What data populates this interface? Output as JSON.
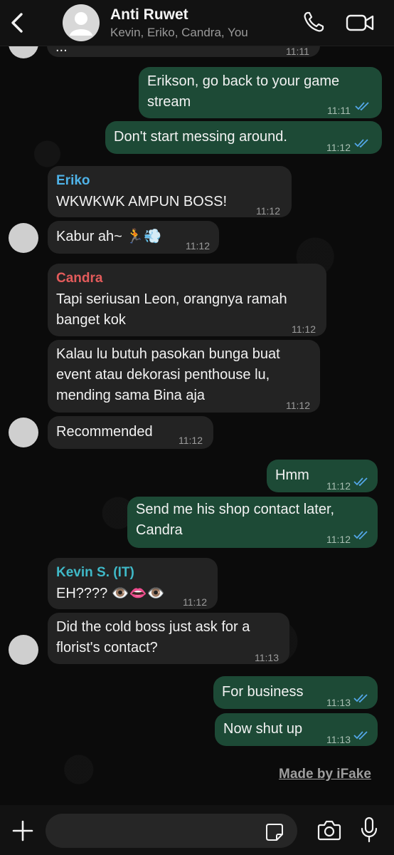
{
  "header": {
    "title": "Anti Ruwet",
    "members": "Kevin, Eriko, Candra, You"
  },
  "messages": [
    {
      "dir": "in",
      "text": "...",
      "time": "11:11"
    },
    {
      "dir": "out",
      "line1": "Erikson, go back to your game",
      "line2": "stream",
      "time": "11:11"
    },
    {
      "dir": "out",
      "text": "Don't start messing around.",
      "time": "11:12"
    },
    {
      "dir": "in",
      "sender": "Eriko",
      "sender_color": "#4fb3e8",
      "text": "WKWKWK AMPUN BOSS!",
      "time": "11:12"
    },
    {
      "dir": "in",
      "text": "Kabur ah~ 🏃💨",
      "time": "11:12"
    },
    {
      "dir": "in",
      "sender": "Candra",
      "sender_color": "#e35b5b",
      "line1": "Tapi seriusan Leon, orangnya ramah",
      "line2": "banget kok",
      "time": "11:12"
    },
    {
      "dir": "in",
      "line1": "Kalau lu butuh pasokan bunga buat",
      "line2": "event atau dekorasi penthouse lu,",
      "line3": "mending sama Bina aja",
      "time": "11:12"
    },
    {
      "dir": "in",
      "text": "Recommended",
      "time": "11:12"
    },
    {
      "dir": "out",
      "text": "Hmm",
      "time": "11:12"
    },
    {
      "dir": "out",
      "line1": "Send me his shop contact later,",
      "line2": "Candra",
      "time": "11:12"
    },
    {
      "dir": "in",
      "sender": "Kevin S. (IT)",
      "sender_color": "#3fb9c8",
      "text": "EH???? 👁️👄👁️",
      "time": "11:12"
    },
    {
      "dir": "in",
      "line1": "Did the cold boss just ask for a",
      "line2": "florist's contact?",
      "time": "11:13"
    },
    {
      "dir": "out",
      "text": "For business",
      "time": "11:13"
    },
    {
      "dir": "out",
      "text": "Now shut up",
      "time": "11:13"
    }
  ],
  "watermark": "Made by iFake",
  "input": {
    "placeholder": ""
  },
  "colors": {
    "outgoing": "#1d4a36",
    "incoming": "#232323",
    "read_tick": "#53a7e8"
  }
}
